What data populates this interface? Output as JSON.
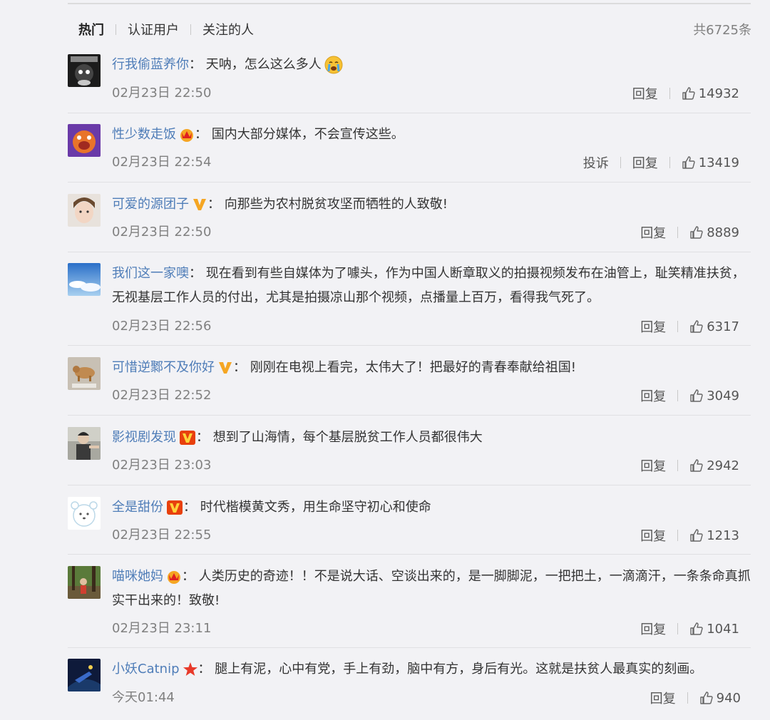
{
  "tabs": [
    "热门",
    "认证用户",
    "关注的人"
  ],
  "total_count": "共6725条",
  "actions": {
    "report": "投诉",
    "reply": "回复"
  },
  "icons": {
    "like": "thumbs-up-icon",
    "crown": "crown-icon",
    "verified_gold": "verified-v-gold-icon",
    "verified_red": "verified-v-red-icon",
    "star": "star-icon"
  },
  "colors": {
    "username": "#4f7db8",
    "background": "#f2f2f5",
    "timestamp": "#808080"
  },
  "comments": [
    {
      "username": "行我偷蓝养你",
      "separator": "：",
      "text": "天呐，怎么这么多人",
      "emoji": "crying-face-icon",
      "time": "02月23日 22:50",
      "likes": "14932"
    },
    {
      "username": "性少数走饭",
      "badge": "crown-icon",
      "separator": "：",
      "text": "国内大部分媒体，不会宣传这些。",
      "time": "02月23日 22:54",
      "likes": "13419",
      "has_report": true
    },
    {
      "username": "可爱的源团子",
      "badge": "verified-v-gold-icon",
      "separator": "：",
      "text": "向那些为农村脱贫攻坚而牺牲的人致敬!",
      "time": "02月23日 22:50",
      "likes": "8889"
    },
    {
      "username": "我们这一家噢",
      "separator": "：",
      "text": "现在看到有些自媒体为了噱头，作为中国人断章取义的拍摄视频发布在油管上，耻笑精准扶贫，无视基层工作人员的付出，尤其是拍摄凉山那个视频，点播量上百万，看得我气死了。",
      "time": "02月23日 22:56",
      "likes": "6317"
    },
    {
      "username": "可惜逆鄹不及你好",
      "badge": "verified-v-gold-icon",
      "separator": "：",
      "text": "刚刚在电视上看完，太伟大了！把最好的青春奉献给祖国!",
      "time": "02月23日 22:52",
      "likes": "3049"
    },
    {
      "username": "影视剧发现",
      "badge": "verified-v-red-icon",
      "separator": "：",
      "text": "想到了山海情，每个基层脱贫工作人员都很伟大",
      "time": "02月23日 23:03",
      "likes": "2942"
    },
    {
      "username": "全是甜份",
      "badge": "verified-v-red-icon",
      "separator": "：",
      "text": "时代楷模黄文秀，用生命坚守初心和使命",
      "time": "02月23日 22:55",
      "likes": "1213"
    },
    {
      "username": "喵咪她妈",
      "badge": "crown-icon",
      "separator": "：",
      "text": "人类历史的奇迹！！不是说大话、空谈出来的，是一脚脚泥，一把把土，一滴滴汗，一条条命真抓实干出来的！致敬!",
      "time": "02月23日 23:11",
      "likes": "1041"
    },
    {
      "username": "小妖Catnip",
      "badge": "star-icon",
      "separator": "：",
      "text": "腿上有泥，心中有党，手上有劲，脑中有方，身后有光。这就是扶贫人最真实的刻画。",
      "time": "今天01:44",
      "likes": "940"
    }
  ]
}
